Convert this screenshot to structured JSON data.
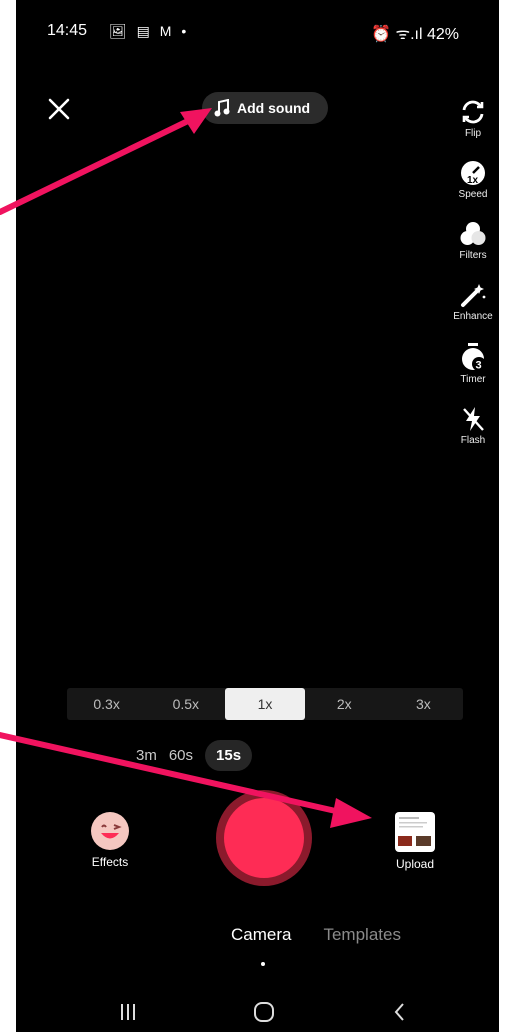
{
  "status": {
    "time": "14:45",
    "notif_icons": "🖼 ▤ M •",
    "right_icons": "⏰ ᯤ.ıl",
    "battery": "42%"
  },
  "header": {
    "close_icon": "close-icon",
    "add_sound_label": "Add sound"
  },
  "tools": [
    {
      "label": "Flip",
      "icon": "flip-icon"
    },
    {
      "label": "Speed",
      "icon": "speed-icon"
    },
    {
      "label": "Filters",
      "icon": "filters-icon"
    },
    {
      "label": "Enhance",
      "icon": "enhance-icon"
    },
    {
      "label": "Timer",
      "icon": "timer-icon"
    },
    {
      "label": "Flash",
      "icon": "flash-icon"
    }
  ],
  "speed_options": [
    "0.3x",
    "0.5x",
    "1x",
    "2x",
    "3x"
  ],
  "speed_selected": "1x",
  "durations": [
    "3m",
    "60s",
    "15s"
  ],
  "duration_selected": "15s",
  "effects_label": "Effects",
  "upload_label": "Upload",
  "modes": [
    "Camera",
    "Templates"
  ],
  "mode_selected": "Camera",
  "colors": {
    "record": "#fe2c55",
    "annotation_arrow": "#f0135f"
  }
}
